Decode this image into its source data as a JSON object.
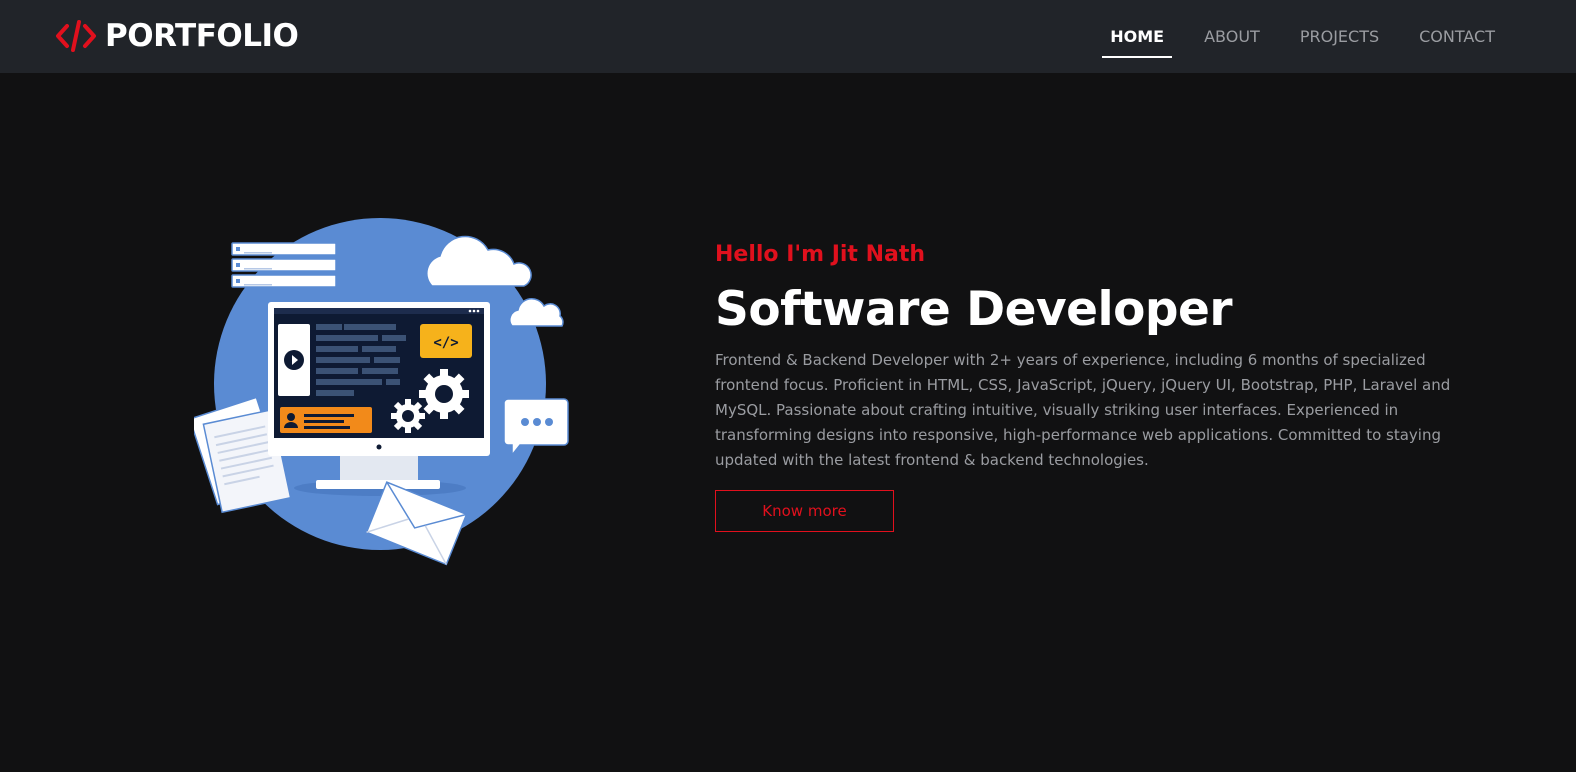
{
  "brand": {
    "icon": "code-brackets-icon",
    "name": "PORTFOLIO"
  },
  "nav": {
    "items": [
      {
        "label": "HOME",
        "active": true
      },
      {
        "label": "ABOUT",
        "active": false
      },
      {
        "label": "PROJECTS",
        "active": false
      },
      {
        "label": "CONTACT",
        "active": false
      }
    ]
  },
  "hero": {
    "greeting": "Hello I'm Jit Nath",
    "headline": "Software Developer",
    "description": "Frontend & Backend Developer with 2+ years of experience, including 6 months of specialized frontend focus. Proficient in HTML, CSS, JavaScript, jQuery, jQuery UI, Bootstrap, PHP, Laravel and MySQL. Passionate about crafting intuitive, visually striking user interfaces. Experienced in transforming designs into responsive, high-performance web applications. Committed to staying updated with the latest frontend & backend technologies.",
    "cta_label": "Know more",
    "illustration": {
      "icon": "developer-workstation-illustration",
      "code_badge": "</>"
    }
  },
  "colors": {
    "accent": "#e1101d",
    "navbar_bg": "#212429",
    "page_bg": "#111112",
    "muted_text": "#9a9ca1",
    "illustration_blue": "#5a8bd3",
    "screen_navy": "#0e1a33",
    "badge_orange": "#f28a1a",
    "badge_yellow": "#f6b21b"
  }
}
